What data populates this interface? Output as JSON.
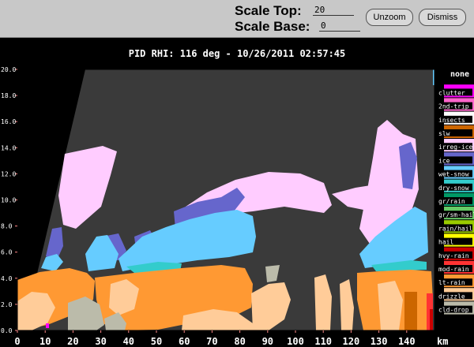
{
  "toolbar": {
    "scale_top_label": "Scale Top:",
    "scale_top_value": "20",
    "scale_base_label": "Scale Base:",
    "scale_base_value": "0",
    "unzoom_label": "Unzoom",
    "dismiss_label": "Dismiss"
  },
  "plot": {
    "title": "PID  RHI: 116 deg  -  10/26/2011 02:57:45",
    "x_unit": "km",
    "background_color": "#3a3a3a",
    "y_ticks": [
      "20.0",
      "18.0",
      "16.0",
      "14.0",
      "12.0",
      "10.0",
      "8.0",
      "6.0",
      "4.0",
      "2.0",
      "0.0"
    ],
    "x_ticks": [
      "0",
      "10",
      "20",
      "30",
      "40",
      "50",
      "60",
      "70",
      "80",
      "90",
      "100",
      "110",
      "120",
      "130",
      "140"
    ]
  },
  "legend": {
    "items": [
      {
        "label": "none",
        "color": "#000000"
      },
      {
        "label": "clutter",
        "color": "#ff00ff"
      },
      {
        "label": "2nd-trip",
        "color": "#ff66cc"
      },
      {
        "label": "insects",
        "color": "#ffffff"
      },
      {
        "label": "slw",
        "color": "#cc6600"
      },
      {
        "label": "irreg-ice",
        "color": "#ffccff"
      },
      {
        "label": "ice",
        "color": "#6666cc"
      },
      {
        "label": "wet-snow",
        "color": "#66ccff"
      },
      {
        "label": "dry-snow",
        "color": "#33cccc"
      },
      {
        "label": "gr/rain",
        "color": "#009966"
      },
      {
        "label": "gr/sm-hail",
        "color": "#66cc66"
      },
      {
        "label": "rain/hail",
        "color": "#99cc00"
      },
      {
        "label": "hail",
        "color": "#ffff00"
      },
      {
        "label": "hvy-rain",
        "color": "#cc0000"
      },
      {
        "label": "mod-rain",
        "color": "#ff3333"
      },
      {
        "label": "lt-rain",
        "color": "#ff9933"
      },
      {
        "label": "drizzle",
        "color": "#ffcc99"
      },
      {
        "label": "cld-drop",
        "color": "#bbbbaa"
      }
    ]
  }
}
